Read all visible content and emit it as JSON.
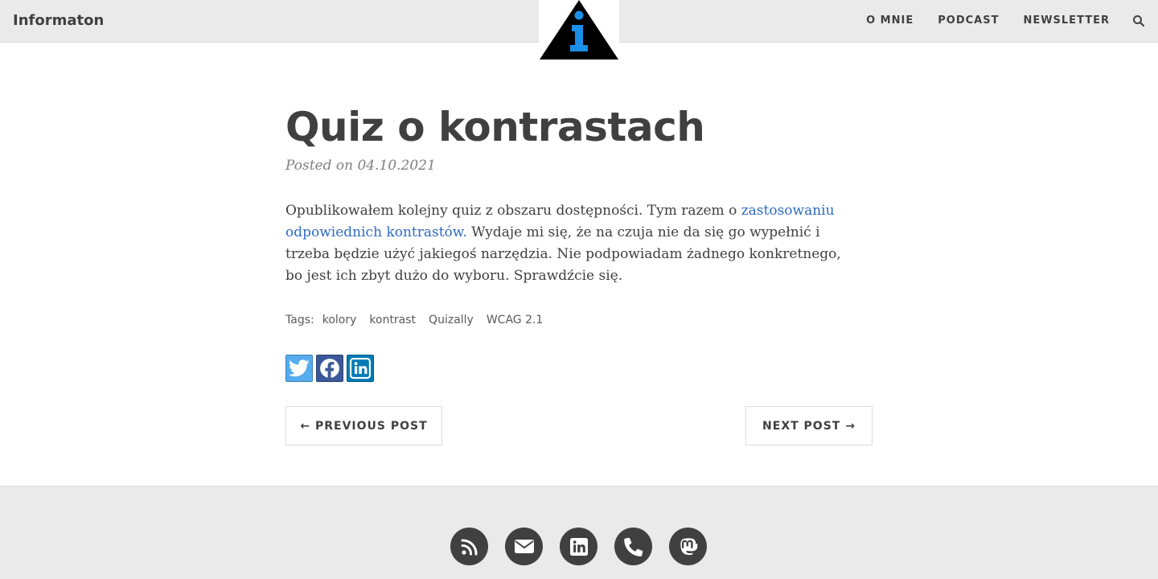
{
  "navbar": {
    "brand": "Informaton",
    "logo_icon": "info-triangle-logo",
    "links": [
      {
        "label": "O MNIE"
      },
      {
        "label": "PODCAST"
      },
      {
        "label": "NEWSLETTER"
      }
    ],
    "search_icon": "search-icon"
  },
  "post": {
    "title": "Quiz o kontrastach",
    "meta": "Posted on 04.10.2021",
    "body": {
      "text_before_link": "Opublikowałem kolejny quiz z obszaru dostępności. Tym razem o ",
      "link_text": "zastosowaniu odpowiednich kontrastów.",
      "text_after_link": " Wydaje mi się, że na czuja nie da się go wypełnić i trzeba będzie użyć jakiegoś narzędzia. Nie podpowiadam żadnego konkretnego, bo jest ich zbyt dużo do wyboru. Sprawdźcie się."
    },
    "tags_label": "Tags:",
    "tags": [
      "kolory",
      "kontrast",
      "Quizally",
      "WCAG 2.1"
    ],
    "share": [
      {
        "icon": "twitter-icon",
        "color": "#55acee"
      },
      {
        "icon": "facebook-icon",
        "color": "#3b5998"
      },
      {
        "icon": "linkedin-icon",
        "color": "#007bb6"
      }
    ],
    "pager": {
      "prev_label": "← PREVIOUS POST",
      "next_label": "NEXT POST →"
    }
  },
  "footer": {
    "icons": [
      "rss-icon",
      "email-icon",
      "linkedin-icon",
      "phone-icon",
      "mastodon-icon"
    ],
    "icon_bg_color": "#404040"
  },
  "colors": {
    "navbar_bg": "#eaeaea",
    "link": "#2e6bc4",
    "text": "#404040",
    "meta": "#808080",
    "logo_accent": "#1a8fe8"
  }
}
